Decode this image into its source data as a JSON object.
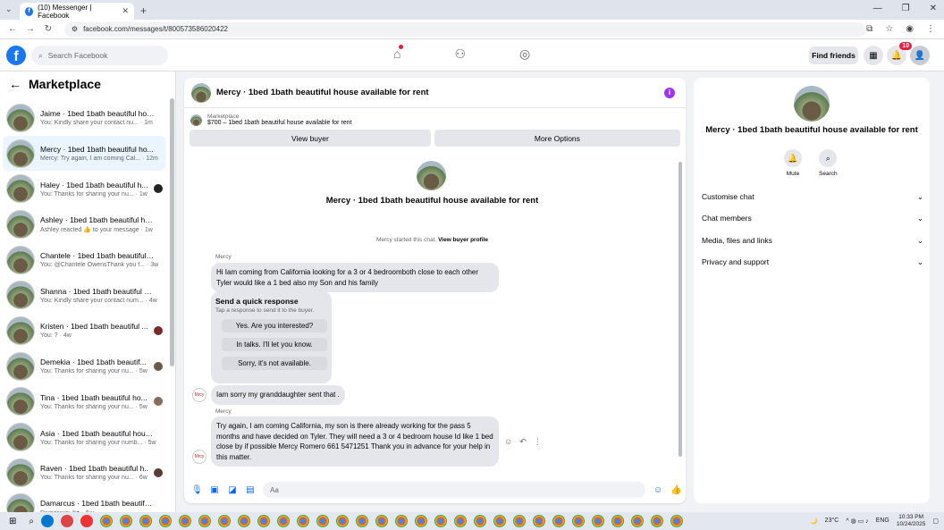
{
  "browser": {
    "tab_title": "(10) Messenger | Facebook",
    "url": "facebook.com/messages/t/800573586020422"
  },
  "fb": {
    "search_placeholder": "Search Facebook",
    "find_friends": "Find friends",
    "notification_count": "10"
  },
  "left": {
    "title": "Marketplace",
    "conversations": [
      {
        "name": "Jaime · 1bed 1bath beautiful hou...",
        "preview": "You: Kindly share your contact nu... · 1m",
        "indicator": ""
      },
      {
        "name": "Mercy · 1bed 1bath beautiful ho...",
        "preview": "Mercy: Try again, I am coming Cal... · 12m",
        "indicator": ""
      },
      {
        "name": "Haley · 1bed 1bath beautiful h...",
        "preview": "You: Thanks for sharing your nu... · 1w",
        "indicator": "#222222"
      },
      {
        "name": "Ashley · 1bed 1bath beautiful ho...",
        "preview": "Ashley reacted 👍 to your message · 1w",
        "indicator": ""
      },
      {
        "name": "Chantele · 1bed 1bath beautiful ...",
        "preview": "You: @Chantele OwensThank you f... · 3w",
        "indicator": ""
      },
      {
        "name": "Shanna · 1bed 1bath beautiful h...",
        "preview": "You: Kindly share your contact num... · 4w",
        "indicator": ""
      },
      {
        "name": "Kristen · 1bed 1bath beautiful ...",
        "preview": "You: ? · 4w",
        "indicator": "#7a2a2a"
      },
      {
        "name": "Demekia · 1bed 1bath beautif...",
        "preview": "You: Thanks for sharing your nu... · 5w",
        "indicator": "#6b5a45"
      },
      {
        "name": "Tina · 1bed 1bath beautiful ho...",
        "preview": "You: Thanks for sharing your nu... · 5w",
        "indicator": "#8a6a5a"
      },
      {
        "name": "Asia · 1bed 1bath beautiful hous...",
        "preview": "You: Thanks for sharing your numb... · 5w",
        "indicator": ""
      },
      {
        "name": "Raven · 1bed 1bath beautiful h...",
        "preview": "You: Thanks for sharing your nu... · 6w",
        "indicator": "#5a3a3a"
      },
      {
        "name": "Damarcus · 1bed 1bath beautiful...",
        "preview": "Damarcus: 📷 · 6w",
        "indicator": ""
      }
    ]
  },
  "chat": {
    "title": "Mercy · 1bed 1bath beautiful house available for rent",
    "mkt_label": "Marketplace",
    "mkt_listing": "$700 – 1bed 1bath beautiful house available for rent",
    "view_buyer": "View buyer",
    "more_options": "More Options",
    "body_title": "Mercy · 1bed 1bath beautiful house available for rent",
    "started_text": "Mercy started this chat.",
    "view_profile": "View buyer profile",
    "sender1": "Mercy",
    "msg1": "Hi Iam coming from California looking for a 3 or 4 bedroomboth close to each other Tyler would like a 1 bed also my Son and his family",
    "quick_title": "Send a quick response",
    "quick_sub": "Tap a response to send it to the buyer.",
    "quick_options": [
      "Yes. Are you interested?",
      "In talks. I'll let you know.",
      "Sorry, it's not available."
    ],
    "msg2": "Iam sorry my granddaughter sent that .",
    "sender2": "Mercy",
    "msg3": "Try again, I am coming California, my son is there already working for the pass 5 months and have decided on Tyler. They will need a 3 or 4 bedroom house Id like 1 bed close by if possible                    Mercy Romero 661 5471251 Thank you in advance for your help in this matter.",
    "avatar_label": "Mrcy",
    "composer_placeholder": "Aa"
  },
  "right": {
    "title": "Mercy · 1bed 1bath beautiful house available for rent",
    "mute": "Mute",
    "search": "Search",
    "menu": [
      "Customise chat",
      "Chat members",
      "Media, files and links",
      "Privacy and support"
    ]
  },
  "taskbar": {
    "weather": "23°C",
    "lang": "ENG",
    "time": "10:33 PM",
    "date": "10/24/2025"
  }
}
